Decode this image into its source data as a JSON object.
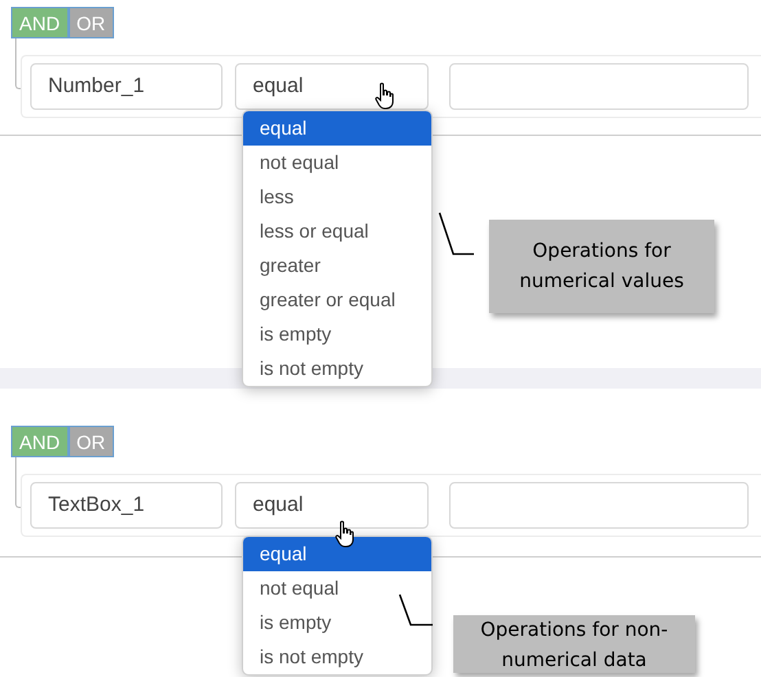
{
  "sections": [
    {
      "logic": [
        {
          "label": "AND",
          "selected": true
        },
        {
          "label": "OR",
          "selected": false
        }
      ],
      "field": "Number_1",
      "operator": "equal",
      "options": [
        {
          "label": "equal",
          "selected": true
        },
        {
          "label": "not equal",
          "selected": false
        },
        {
          "label": "less",
          "selected": false
        },
        {
          "label": "less or equal",
          "selected": false
        },
        {
          "label": "greater",
          "selected": false
        },
        {
          "label": "greater or equal",
          "selected": false
        },
        {
          "label": "is empty",
          "selected": false
        },
        {
          "label": "is not empty",
          "selected": false
        }
      ],
      "callout": "Operations for numerical values"
    },
    {
      "logic": [
        {
          "label": "AND",
          "selected": true
        },
        {
          "label": "OR",
          "selected": false
        }
      ],
      "field": "TextBox_1",
      "operator": "equal",
      "options": [
        {
          "label": "equal",
          "selected": true
        },
        {
          "label": "not equal",
          "selected": false
        },
        {
          "label": "is empty",
          "selected": false
        },
        {
          "label": "is not empty",
          "selected": false
        }
      ],
      "callout": "Operations for non-numerical data"
    }
  ]
}
